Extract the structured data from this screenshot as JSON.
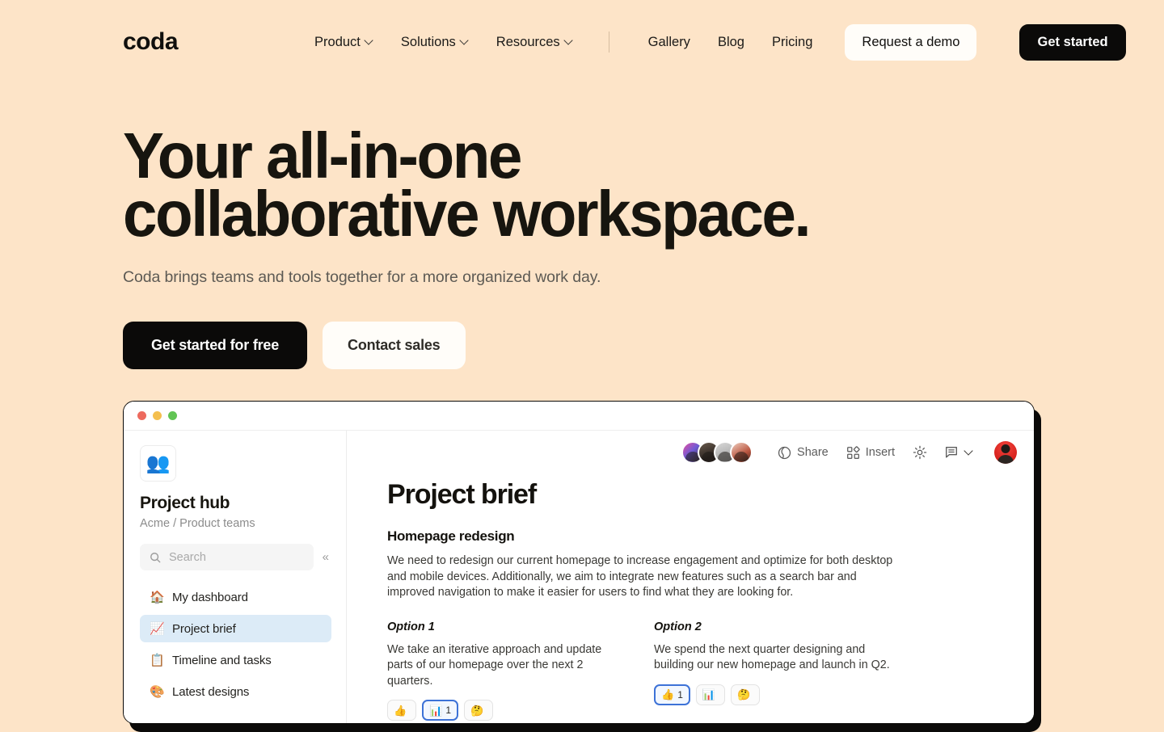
{
  "brand": {
    "logo": "coda"
  },
  "nav": {
    "links": [
      {
        "label": "Product",
        "has_chevron": true,
        "icon": "chevron-down-icon"
      },
      {
        "label": "Solutions",
        "has_chevron": true,
        "icon": "chevron-down-icon"
      },
      {
        "label": "Resources",
        "has_chevron": true,
        "icon": "chevron-down-icon"
      }
    ],
    "right_links": [
      {
        "label": "Gallery"
      },
      {
        "label": "Blog"
      },
      {
        "label": "Pricing"
      }
    ],
    "demo_button": "Request a demo",
    "start_button": "Get started"
  },
  "hero": {
    "headline_line1": "Your all-in-one",
    "headline_line2": "collaborative workspace.",
    "subtitle": "Coda brings teams and tools together for a more organized work day.",
    "primary_cta": "Get started for free",
    "secondary_cta": "Contact sales"
  },
  "app": {
    "window_controls": [
      "close",
      "minimize",
      "maximize"
    ],
    "sidebar": {
      "hub_icon": "busts-in-silhouette-icon",
      "hub_emoji": "👥",
      "title": "Project hub",
      "breadcrumb": "Acme / Product teams",
      "search_placeholder": "Search",
      "search_value": "",
      "search_icon": "search-icon",
      "collapse_icon": "chevrons-left-icon",
      "collapse_glyph": "«",
      "items": [
        {
          "label": "My dashboard",
          "emoji": "🏠",
          "icon": "house-icon",
          "active": false
        },
        {
          "label": "Project brief",
          "emoji": "📈",
          "icon": "chart-increasing-icon",
          "active": true
        },
        {
          "label": "Timeline and tasks",
          "emoji": "📋",
          "icon": "clipboard-icon",
          "active": false
        },
        {
          "label": "Latest designs",
          "emoji": "🎨",
          "icon": "figma-logo-icon",
          "active": false
        }
      ]
    },
    "toolbar": {
      "avatar_count": 4,
      "share_label": "Share",
      "share_icon": "globe-icon",
      "insert_label": "Insert",
      "insert_icon": "grid-insert-icon",
      "settings_icon": "gear-icon",
      "comment_icon": "comment-icon",
      "comment_chevron_icon": "chevron-down-icon",
      "user_avatar": "user-avatar"
    },
    "document": {
      "title": "Project brief",
      "heading": "Homepage redesign",
      "paragraph": "We need to redesign our current homepage to increase engagement and optimize for both desktop and mobile devices. Additionally, we aim to integrate new features such as a search bar and improved navigation to make it easier for users to find what they are looking for.",
      "options": [
        {
          "title": "Option 1",
          "body": "We take an iterative approach and update parts of our homepage over the next 2 quarters.",
          "reactions": [
            {
              "emoji": "👍",
              "count": "",
              "selected": false
            },
            {
              "emoji": "📊",
              "count": "1",
              "selected": true
            },
            {
              "emoji": "🤔",
              "count": "",
              "selected": false
            }
          ]
        },
        {
          "title": "Option 2",
          "body": "We spend the next quarter designing and building our new homepage and launch in Q2.",
          "reactions": [
            {
              "emoji": "👍",
              "count": "1",
              "selected": true
            },
            {
              "emoji": "📊",
              "count": "",
              "selected": false
            },
            {
              "emoji": "🤔",
              "count": "",
              "selected": false
            }
          ]
        }
      ]
    }
  },
  "colors": {
    "background": "#FDE4C8",
    "ink": "#0b0a09",
    "accent_selected": "#dcebf7",
    "reaction_selected_border": "#3d72d7"
  }
}
